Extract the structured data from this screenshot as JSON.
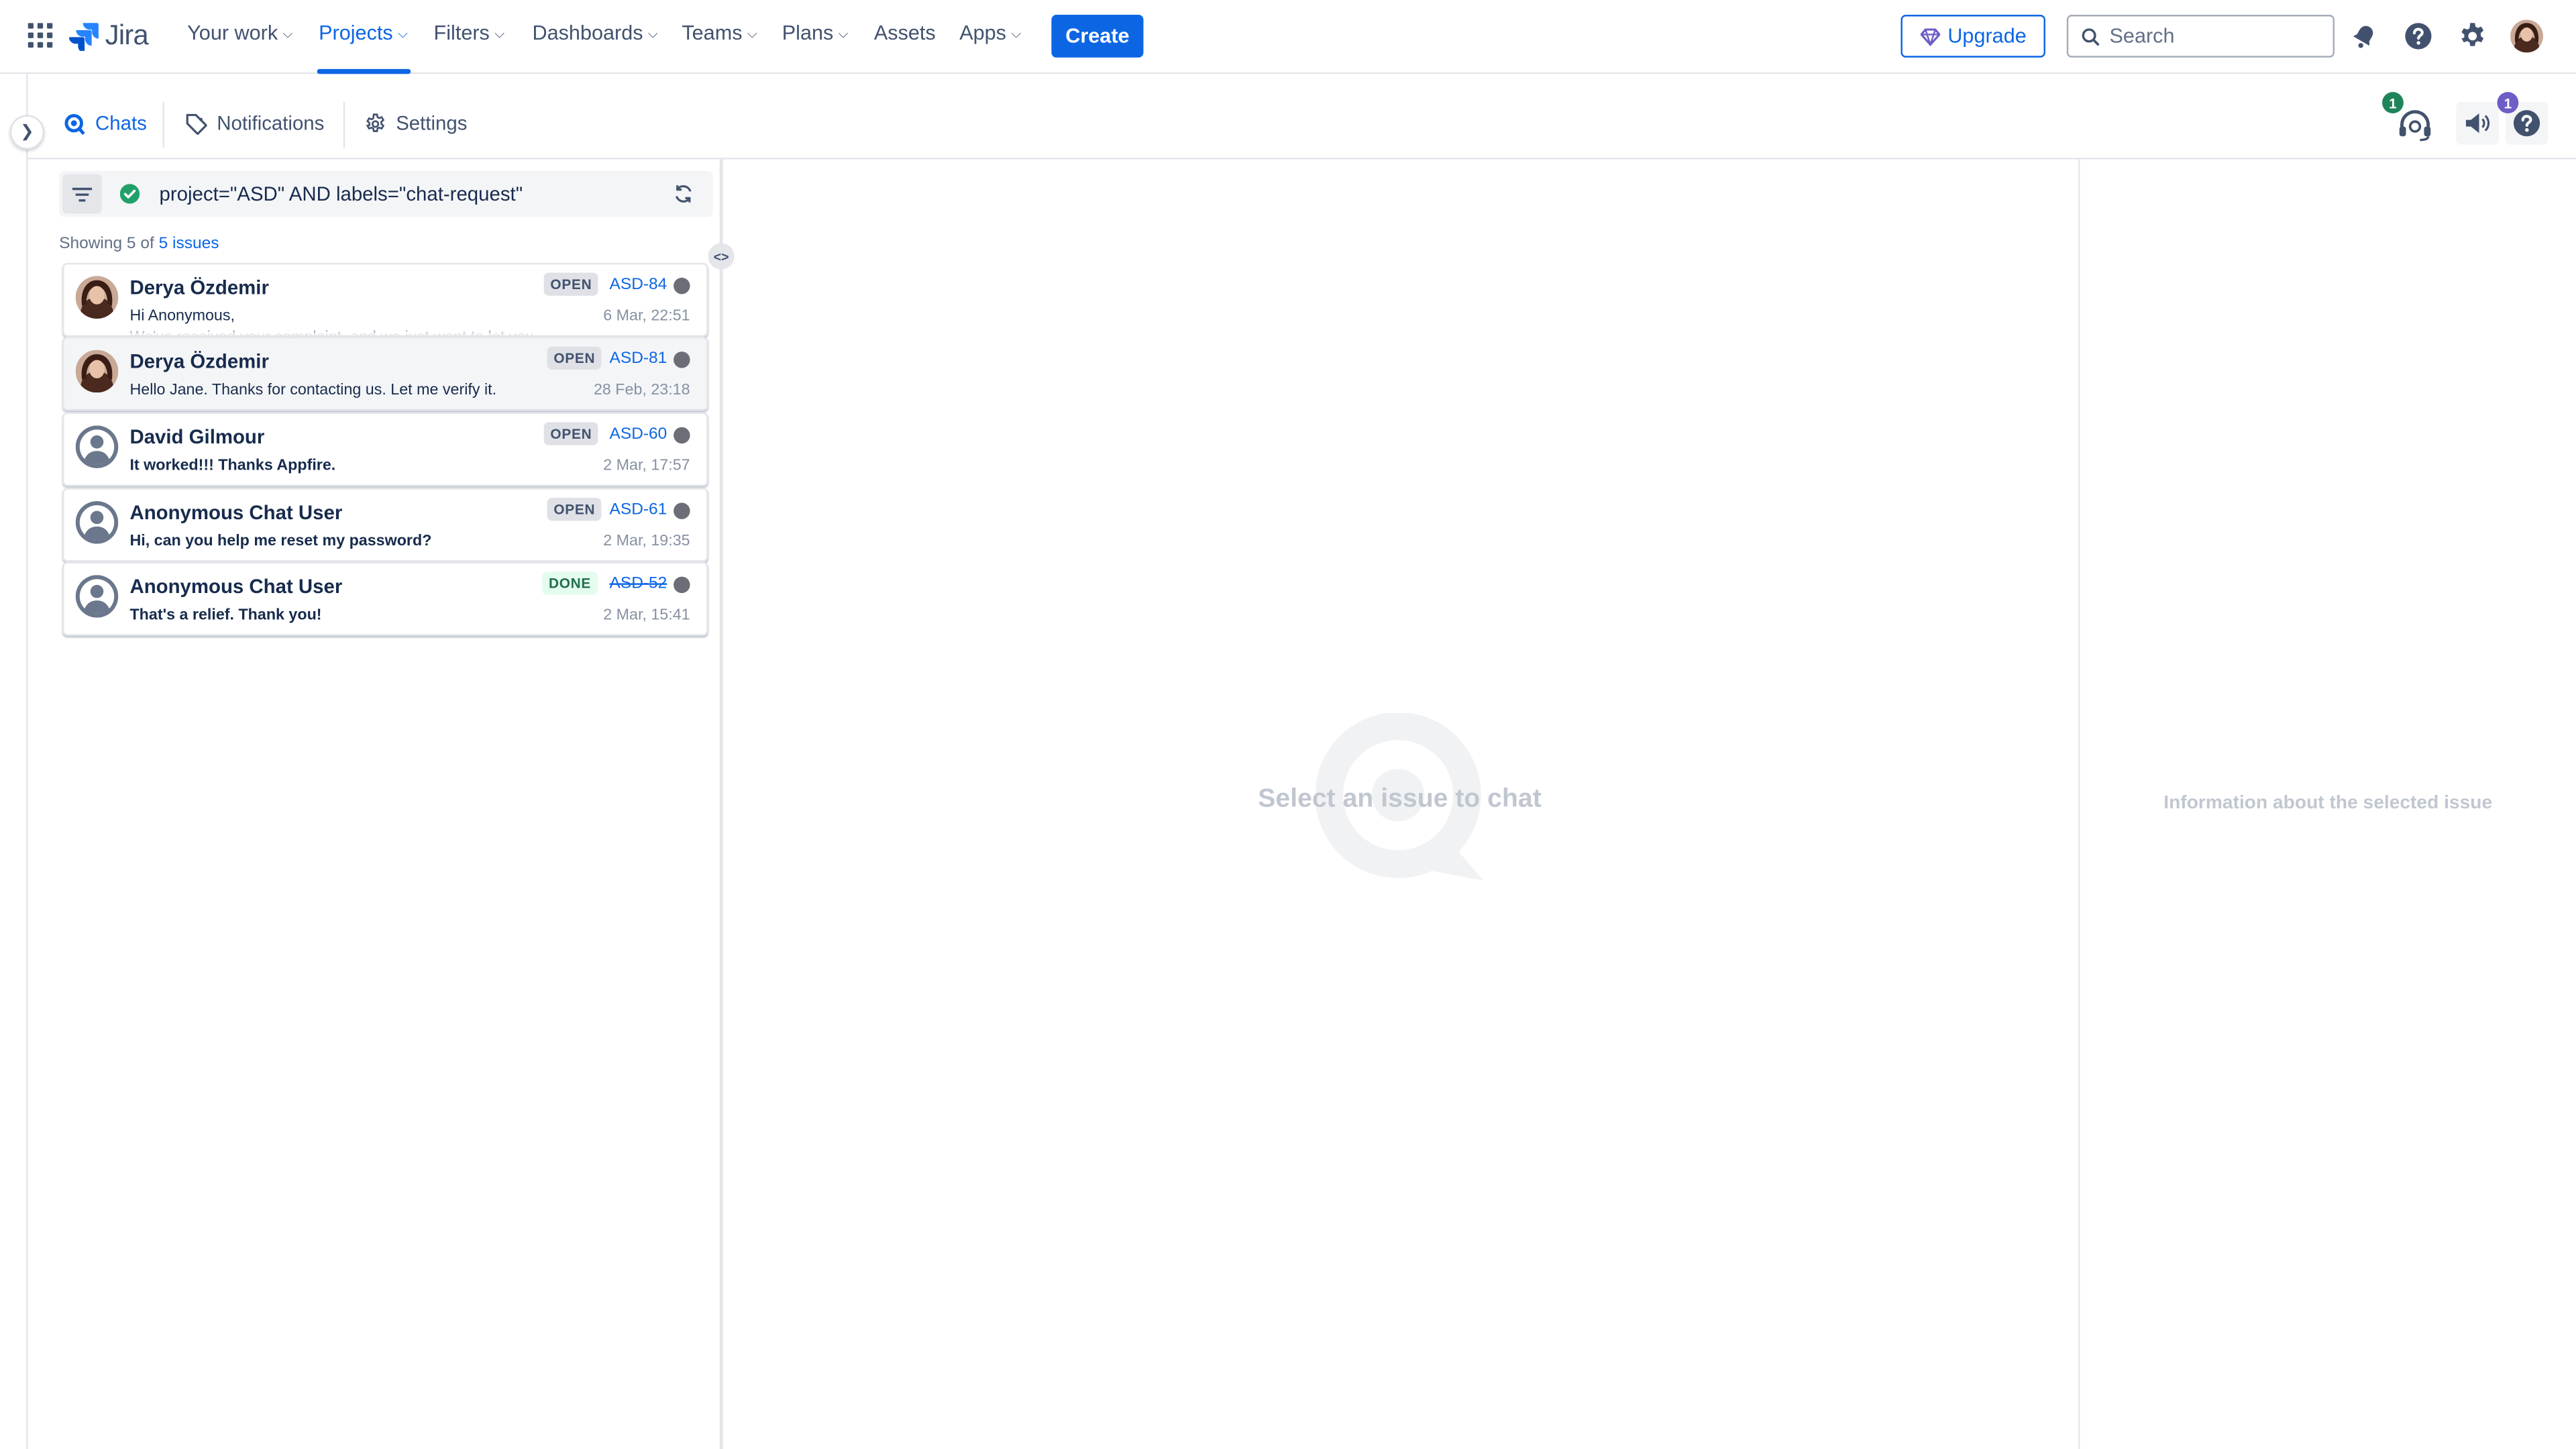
{
  "app": {
    "name": "Jira"
  },
  "nav": {
    "items": [
      {
        "label": "Your work",
        "dropdown": true
      },
      {
        "label": "Projects",
        "dropdown": true,
        "active": true
      },
      {
        "label": "Filters",
        "dropdown": true
      },
      {
        "label": "Dashboards",
        "dropdown": true
      },
      {
        "label": "Teams",
        "dropdown": true
      },
      {
        "label": "Plans",
        "dropdown": true
      },
      {
        "label": "Assets",
        "dropdown": false
      },
      {
        "label": "Apps",
        "dropdown": true
      }
    ],
    "create_label": "Create",
    "upgrade_label": "Upgrade",
    "search_placeholder": "Search"
  },
  "tabs": {
    "chats": "Chats",
    "notifications": "Notifications",
    "settings": "Settings"
  },
  "toolbar_badges": {
    "agent": "1",
    "help": "1"
  },
  "filter": {
    "query": "project=\"ASD\" AND labels=\"chat-request\"",
    "showing_prefix": "Showing 5 of",
    "showing_link": "5 issues"
  },
  "issues": [
    {
      "name": "Derya Özdemir",
      "message": "Hi Anonymous,",
      "message2": "We've received your complaint, and we just want to let you",
      "status": "OPEN",
      "key": "ASD-84",
      "time": "6 Mar, 22:51",
      "avatar": "photo",
      "bold": false
    },
    {
      "name": "Derya Özdemir",
      "message": "Hello Jane. Thanks for contacting us. Let me verify it.",
      "status": "OPEN",
      "key": "ASD-81",
      "time": "28 Feb, 23:18",
      "avatar": "photo",
      "bold": false,
      "selected": true
    },
    {
      "name": "David Gilmour",
      "message": "It worked!!! Thanks Appfire.",
      "status": "OPEN",
      "key": "ASD-60",
      "time": "2 Mar, 17:57",
      "avatar": "default",
      "bold": true
    },
    {
      "name": "Anonymous Chat User",
      "message": "Hi, can you help me reset my password?",
      "status": "OPEN",
      "key": "ASD-61",
      "time": "2 Mar, 19:35",
      "avatar": "default",
      "bold": true
    },
    {
      "name": "Anonymous Chat User",
      "message": "That's a relief. Thank you!",
      "status": "DONE",
      "key": "ASD-52",
      "time": "2 Mar, 15:41",
      "avatar": "default",
      "bold": true
    }
  ],
  "center": {
    "empty_text": "Select an issue to chat"
  },
  "right": {
    "empty_text": "Information about the selected issue"
  },
  "colors": {
    "accent": "#0c66e4",
    "done": "#216e4e",
    "badge_green": "#1f845a",
    "badge_purple": "#6e5dc6"
  }
}
